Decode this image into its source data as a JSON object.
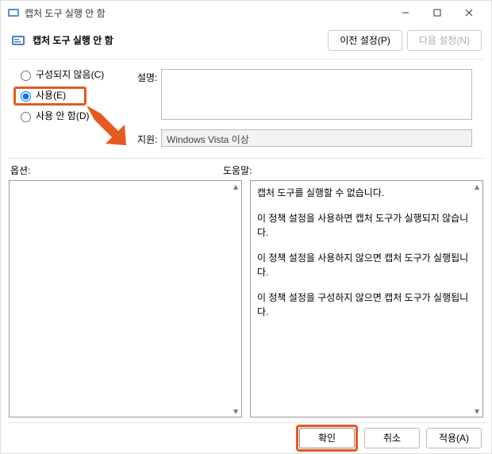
{
  "window": {
    "title": "캡처 도구 실행 안 함"
  },
  "header": {
    "title": "캡처 도구 실행 안 함",
    "prev": "이전 설정(P)",
    "next": "다음 설정(N)"
  },
  "radios": {
    "not_configured": "구성되지 않음(C)",
    "enabled": "사용(E)",
    "disabled": "사용 안 함(D)"
  },
  "labels": {
    "description": "설명:",
    "supported": "지원:",
    "options": "옵션:",
    "help": "도움말:"
  },
  "supported_text": "Windows Vista 이상",
  "help": {
    "p1": "캡처 도구를 실행할 수 없습니다.",
    "p2": "이 정책 설정을 사용하면 캡처 도구가 실행되지 않습니다.",
    "p3": "이 정책 설정을 사용하지 않으면 캡처 도구가 실행됩니다.",
    "p4": "이 정책 설정을 구성하지 않으면 캡처 도구가 실행됩니다."
  },
  "footer": {
    "ok": "확인",
    "cancel": "취소",
    "apply": "적용(A)"
  }
}
